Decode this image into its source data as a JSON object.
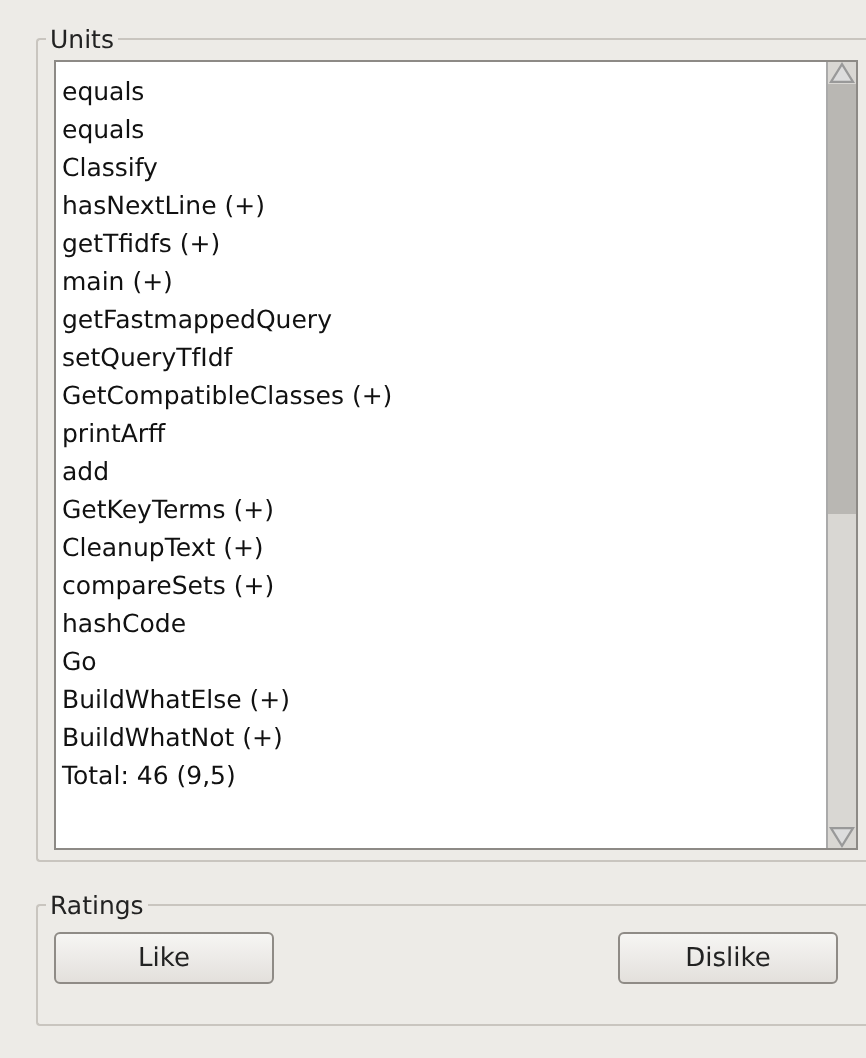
{
  "units": {
    "title": "Units",
    "items": [
      "equals",
      "equals",
      "Classify",
      "hasNextLine (+)",
      "getTfidfs (+)",
      "main (+)",
      "getFastmappedQuery",
      "setQueryTfIdf",
      "GetCompatibleClasses (+)",
      "printArff",
      "add",
      "GetKeyTerms (+)",
      "CleanupText (+)",
      "compareSets (+)",
      "hashCode",
      "Go",
      "BuildWhatElse (+)",
      "BuildWhatNot (+)",
      "Total: 46 (9,5)"
    ]
  },
  "ratings": {
    "title": "Ratings",
    "buttons": [
      "Like",
      "Dislike"
    ]
  }
}
